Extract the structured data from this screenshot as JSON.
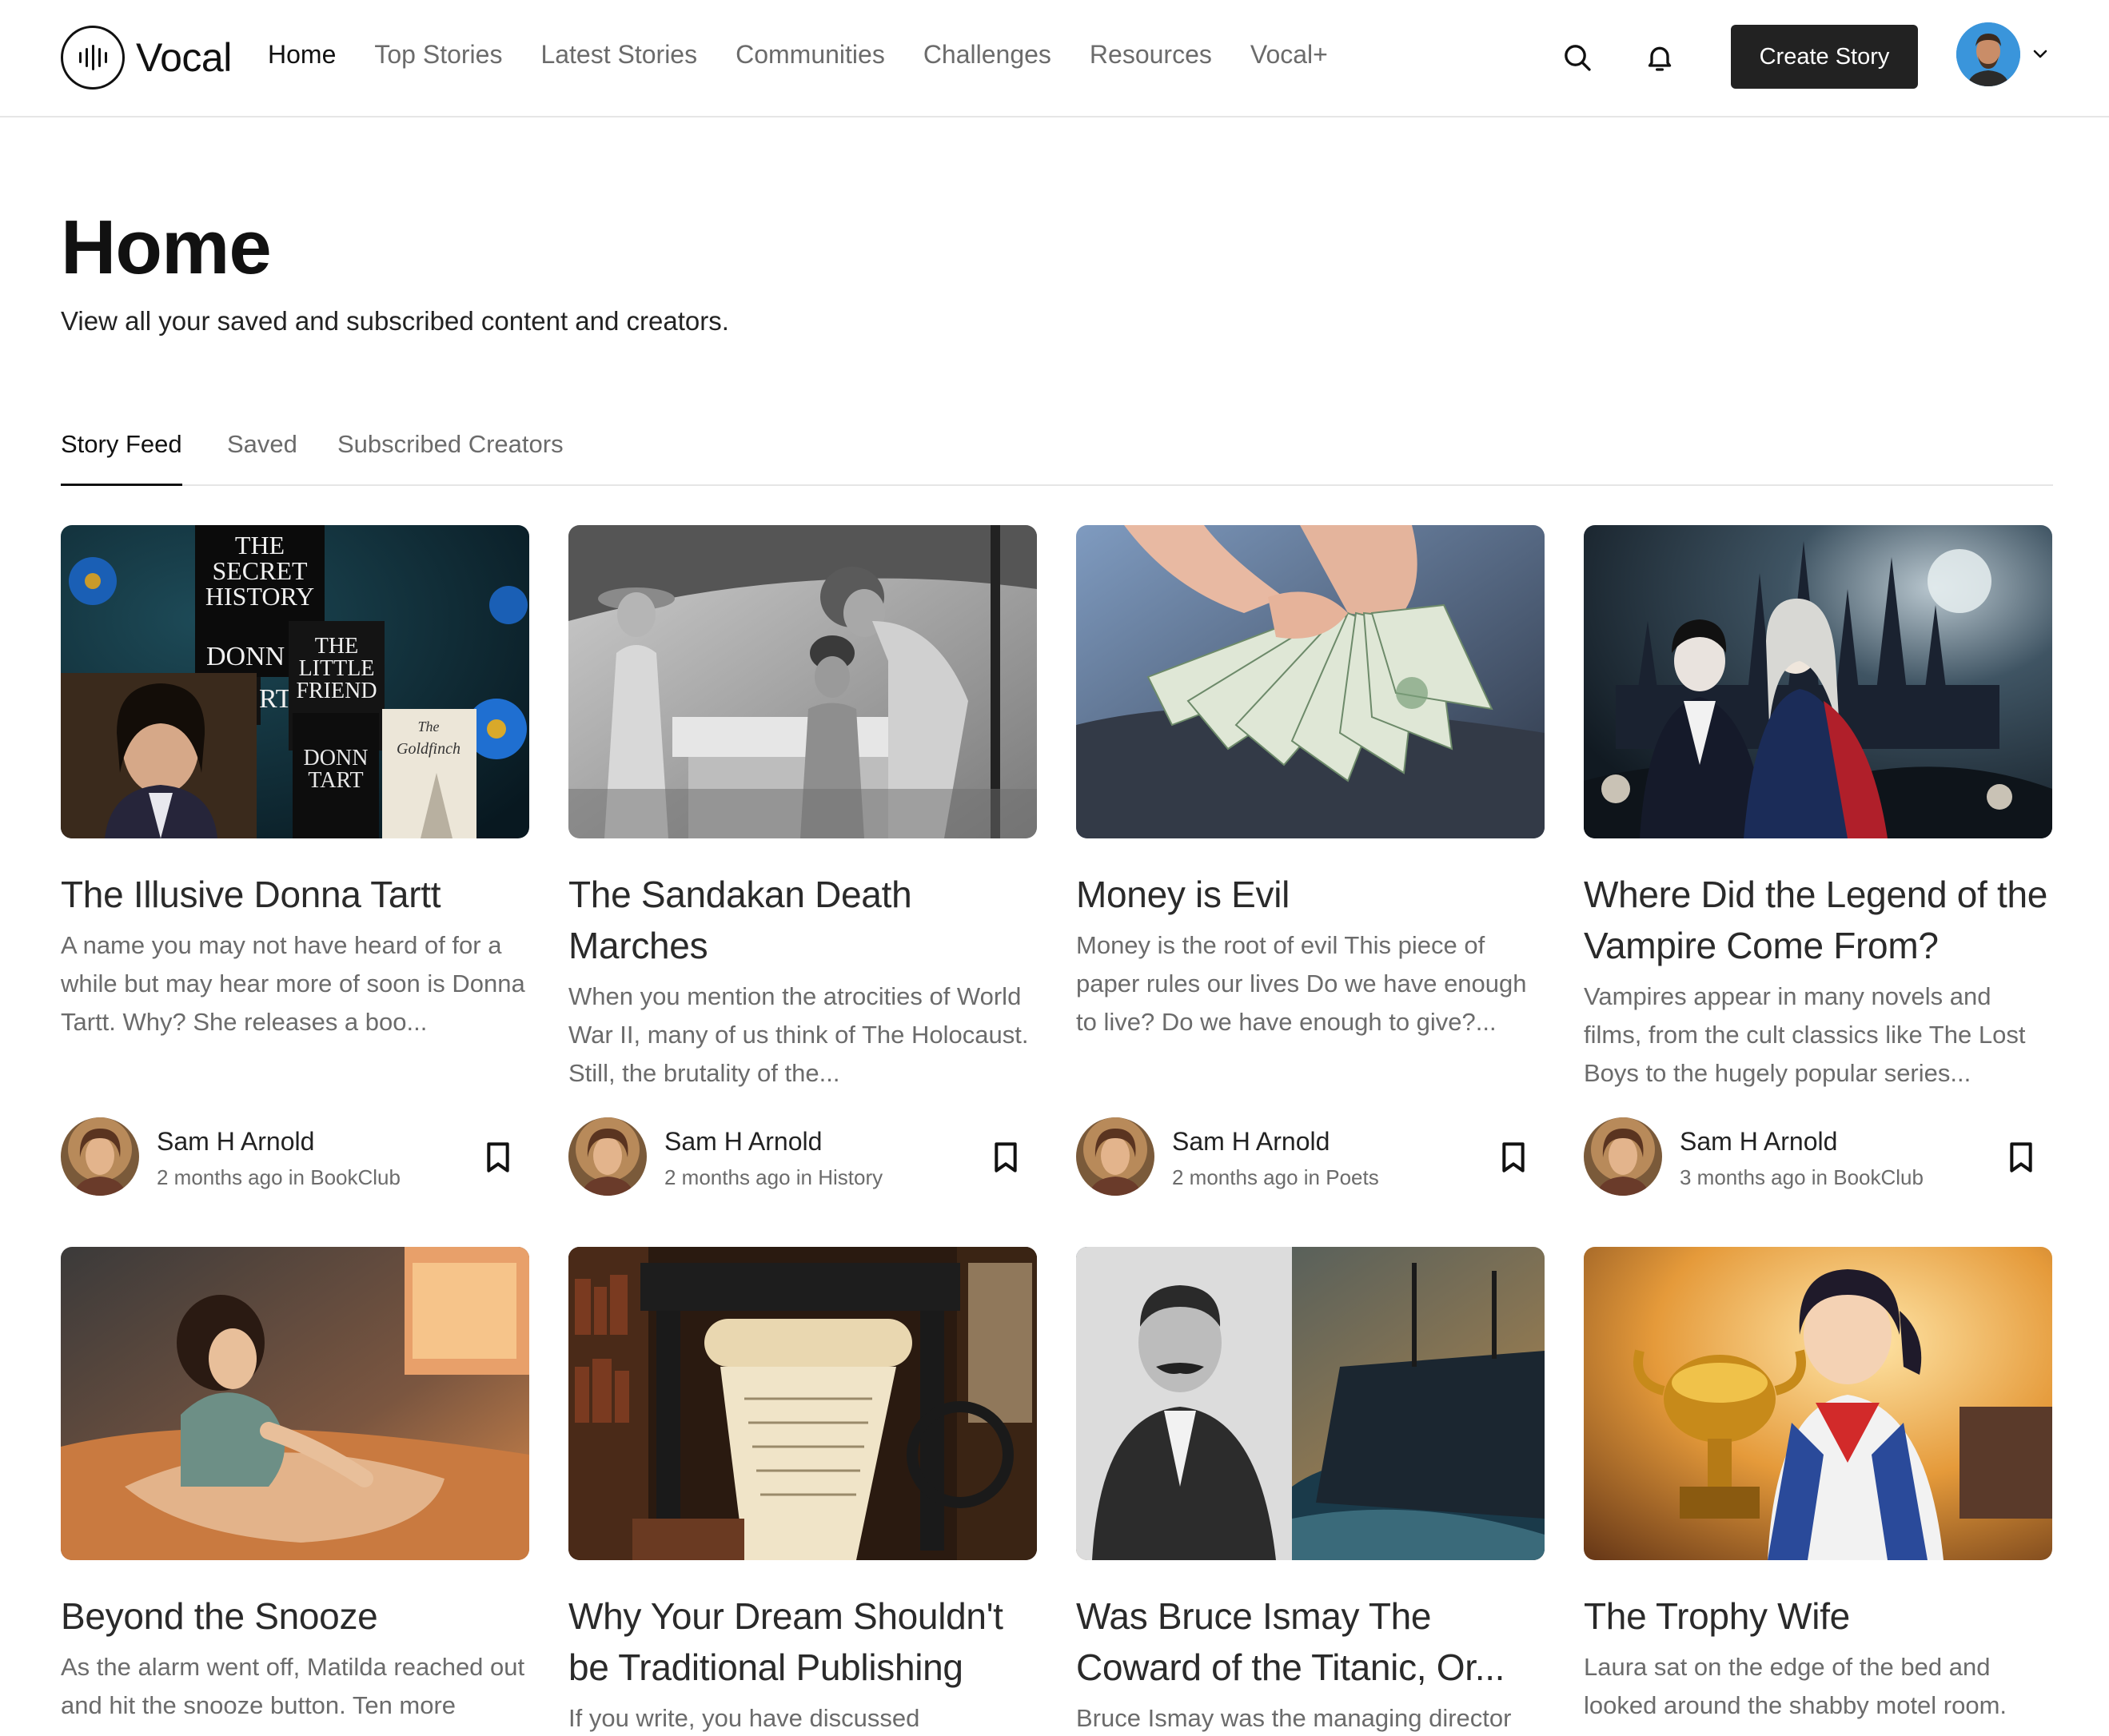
{
  "brand": {
    "name": "Vocal"
  },
  "nav": {
    "items": [
      {
        "label": "Home",
        "active": true
      },
      {
        "label": "Top Stories"
      },
      {
        "label": "Latest Stories"
      },
      {
        "label": "Communities"
      },
      {
        "label": "Challenges"
      },
      {
        "label": "Resources"
      },
      {
        "label": "Vocal+"
      }
    ]
  },
  "header": {
    "search_icon": "search-icon",
    "bell_icon": "bell-icon",
    "create_label": "Create Story",
    "avatar_icon": "user-avatar"
  },
  "page": {
    "title": "Home",
    "subtitle": "View all your saved and subscribed content and creators."
  },
  "tabs": [
    {
      "label": "Story Feed",
      "active": true
    },
    {
      "label": "Saved"
    },
    {
      "label": "Subscribed Creators"
    }
  ],
  "cards": [
    {
      "title": "The Illusive Donna Tartt",
      "excerpt": "A name you may not have heard of for a while but may hear more of soon is Donna Tartt. Why? She releases a boo...",
      "author": "Sam H Arnold",
      "meta": "2 months ago in BookClub",
      "cover_text": [
        "THE",
        "SECRET",
        "HISTORY",
        "DONN",
        "RT",
        "THE",
        "LITTLE",
        "FRIEND",
        "DONN",
        "TART",
        "The",
        "Goldfinch"
      ]
    },
    {
      "title": "The Sandakan Death Marches",
      "excerpt": "When you mention the atrocities of World War II, many of us think of The Holocaust. Still, the brutality of the...",
      "author": "Sam H Arnold",
      "meta": "2 months ago in History"
    },
    {
      "title": "Money is Evil",
      "excerpt": "Money is the root of evil This piece of paper rules our lives Do we have enough to live? Do we have enough to give?...",
      "author": "Sam H Arnold",
      "meta": "2 months ago in Poets"
    },
    {
      "title": "Where Did the Legend of the Vampire Come From?",
      "excerpt": "Vampires appear in many novels and films, from the cult classics like The Lost Boys to the hugely popular series...",
      "author": "Sam H Arnold",
      "meta": "3 months ago in BookClub"
    },
    {
      "title": "Beyond the Snooze",
      "excerpt": "As the alarm went off, Matilda reached out and hit the snooze button. Ten more"
    },
    {
      "title": "Why Your Dream Shouldn't be Traditional Publishing",
      "excerpt": "If you write, you have discussed"
    },
    {
      "title": "Was Bruce Ismay The Coward of the Titanic, Or...",
      "excerpt": "Bruce Ismay was the managing director"
    },
    {
      "title": "The Trophy Wife",
      "excerpt": "Laura sat on the edge of the bed and looked around the shabby motel room."
    }
  ]
}
